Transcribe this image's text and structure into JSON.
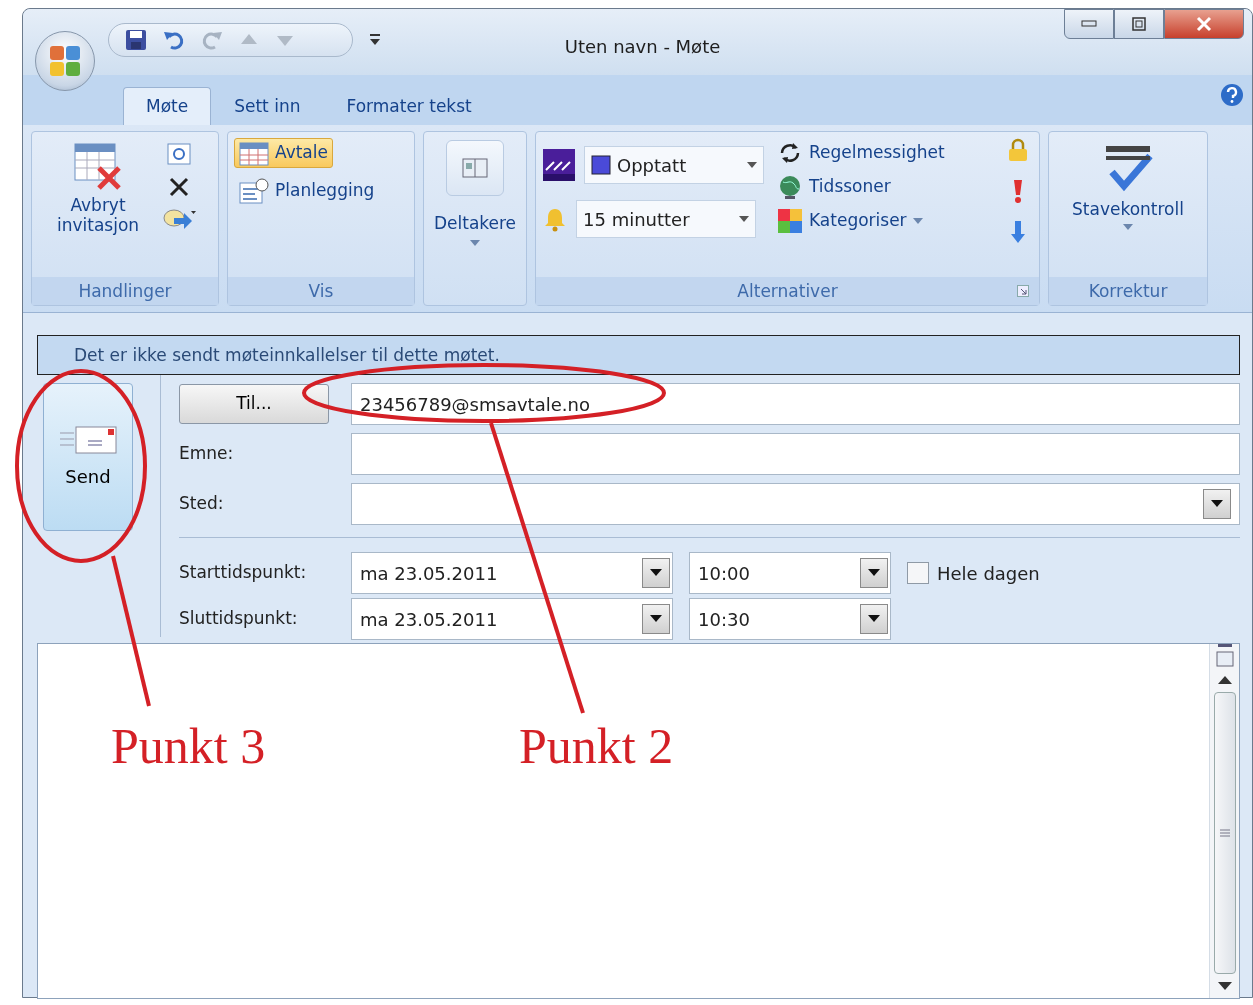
{
  "window": {
    "title": "Uten navn - Møte"
  },
  "tabs": [
    {
      "label": "Møte",
      "selected": true
    },
    {
      "label": "Sett inn",
      "selected": false
    },
    {
      "label": "Formater tekst",
      "selected": false
    }
  ],
  "ribbon": {
    "actions": {
      "label": "Handlinger",
      "cancel_button": "Avbryt invitasjon"
    },
    "show": {
      "label": "Vis",
      "buttons": [
        {
          "label": "Avtale",
          "selected": true
        },
        {
          "label": "Planlegging",
          "selected": false
        }
      ]
    },
    "attendees": {
      "button": "Deltakere"
    },
    "options": {
      "label": "Alternativer",
      "show_as": "Opptatt",
      "reminder": "15 minutter",
      "buttons": [
        "Regelmessighet",
        "Tidssoner",
        "Kategoriser"
      ]
    },
    "proofing": {
      "label": "Korrektur",
      "button": "Stavekontroll"
    }
  },
  "info_bar": "Det er ikke sendt møteinnkallelser til dette møtet.",
  "form": {
    "send_button": "Send",
    "to_button": "Til...",
    "to_value": "23456789@smsavtale.no",
    "subject_label": "Emne:",
    "location_label": "Sted:",
    "start_label": "Starttidspunkt:",
    "start_date": "ma 23.05.2011",
    "start_time": "10:00",
    "all_day": {
      "label": "Hele dagen",
      "checked": false
    },
    "end_label": "Sluttidspunkt:",
    "end_date": "ma 23.05.2011",
    "end_time": "10:30"
  },
  "annotations": [
    {
      "label": "Punkt 3"
    },
    {
      "label": "Punkt 2"
    }
  ]
}
